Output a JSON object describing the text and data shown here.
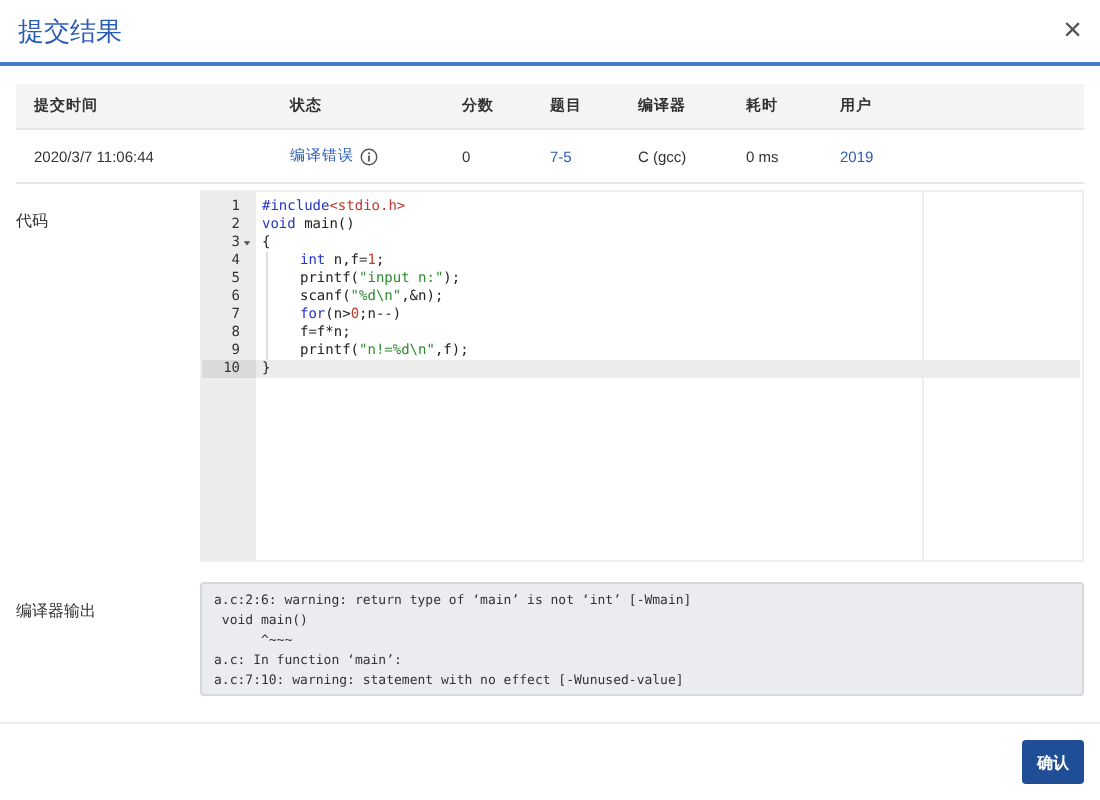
{
  "dialog": {
    "title": "提交结果",
    "close": "×"
  },
  "table": {
    "columns": [
      "提交时间",
      "状态",
      "分数",
      "题目",
      "编译器",
      "耗时",
      "用户"
    ],
    "row": {
      "time": "2020/3/7 11:06:44",
      "status": "编译错误",
      "score": "0",
      "problem": "7-5",
      "compiler": "C (gcc)",
      "duration": "0 ms",
      "user": "2019"
    }
  },
  "code": {
    "label": "代码",
    "lines": [
      {
        "number": "1",
        "fold": false,
        "active": false,
        "indented": false,
        "tokens": [
          {
            "kind": "keyword",
            "t": "#include"
          },
          {
            "kind": "include",
            "t": "<stdio.h>"
          }
        ]
      },
      {
        "number": "2",
        "fold": false,
        "active": false,
        "indented": false,
        "tokens": [
          {
            "kind": "keyword",
            "t": "void"
          },
          {
            "kind": "plain",
            "t": " main()"
          }
        ]
      },
      {
        "number": "3",
        "fold": true,
        "active": false,
        "indented": false,
        "tokens": [
          {
            "kind": "plain",
            "t": "{"
          }
        ]
      },
      {
        "number": "4",
        "fold": false,
        "active": false,
        "indented": true,
        "tokens": [
          {
            "kind": "keyword",
            "t": "int"
          },
          {
            "kind": "plain",
            "t": " n,f="
          },
          {
            "kind": "number",
            "t": "1"
          },
          {
            "kind": "plain",
            "t": ";"
          }
        ]
      },
      {
        "number": "5",
        "fold": false,
        "active": false,
        "indented": true,
        "tokens": [
          {
            "kind": "plain",
            "t": "printf("
          },
          {
            "kind": "string",
            "t": "\"input n:\""
          },
          {
            "kind": "plain",
            "t": ");"
          }
        ]
      },
      {
        "number": "6",
        "fold": false,
        "active": false,
        "indented": true,
        "tokens": [
          {
            "kind": "plain",
            "t": "scanf("
          },
          {
            "kind": "string",
            "t": "\"%d\\n\""
          },
          {
            "kind": "plain",
            "t": ",&n);"
          }
        ]
      },
      {
        "number": "7",
        "fold": false,
        "active": false,
        "indented": true,
        "tokens": [
          {
            "kind": "keyword",
            "t": "for"
          },
          {
            "kind": "plain",
            "t": "(n>"
          },
          {
            "kind": "number",
            "t": "0"
          },
          {
            "kind": "plain",
            "t": ";n--)"
          }
        ]
      },
      {
        "number": "8",
        "fold": false,
        "active": false,
        "indented": true,
        "tokens": [
          {
            "kind": "plain",
            "t": "f=f*n;"
          }
        ]
      },
      {
        "number": "9",
        "fold": false,
        "active": false,
        "indented": true,
        "tokens": [
          {
            "kind": "plain",
            "t": "printf("
          },
          {
            "kind": "string",
            "t": "\"n!=%d\\n\""
          },
          {
            "kind": "plain",
            "t": ",f);"
          }
        ]
      },
      {
        "number": "10",
        "fold": false,
        "active": true,
        "indented": false,
        "tokens": [
          {
            "kind": "plain",
            "t": "}"
          }
        ]
      }
    ]
  },
  "compiler_output": {
    "label": "编译器输出",
    "lines": [
      "a.c:2:6: warning: return type of ‘main’ is not ‘int’ [-Wmain]",
      " void main()",
      "      ^~~~",
      "a.c: In function ‘main’:",
      "a.c:7:10: warning: statement with no effect [-Wunused-value]"
    ]
  },
  "confirm_button": "确认"
}
